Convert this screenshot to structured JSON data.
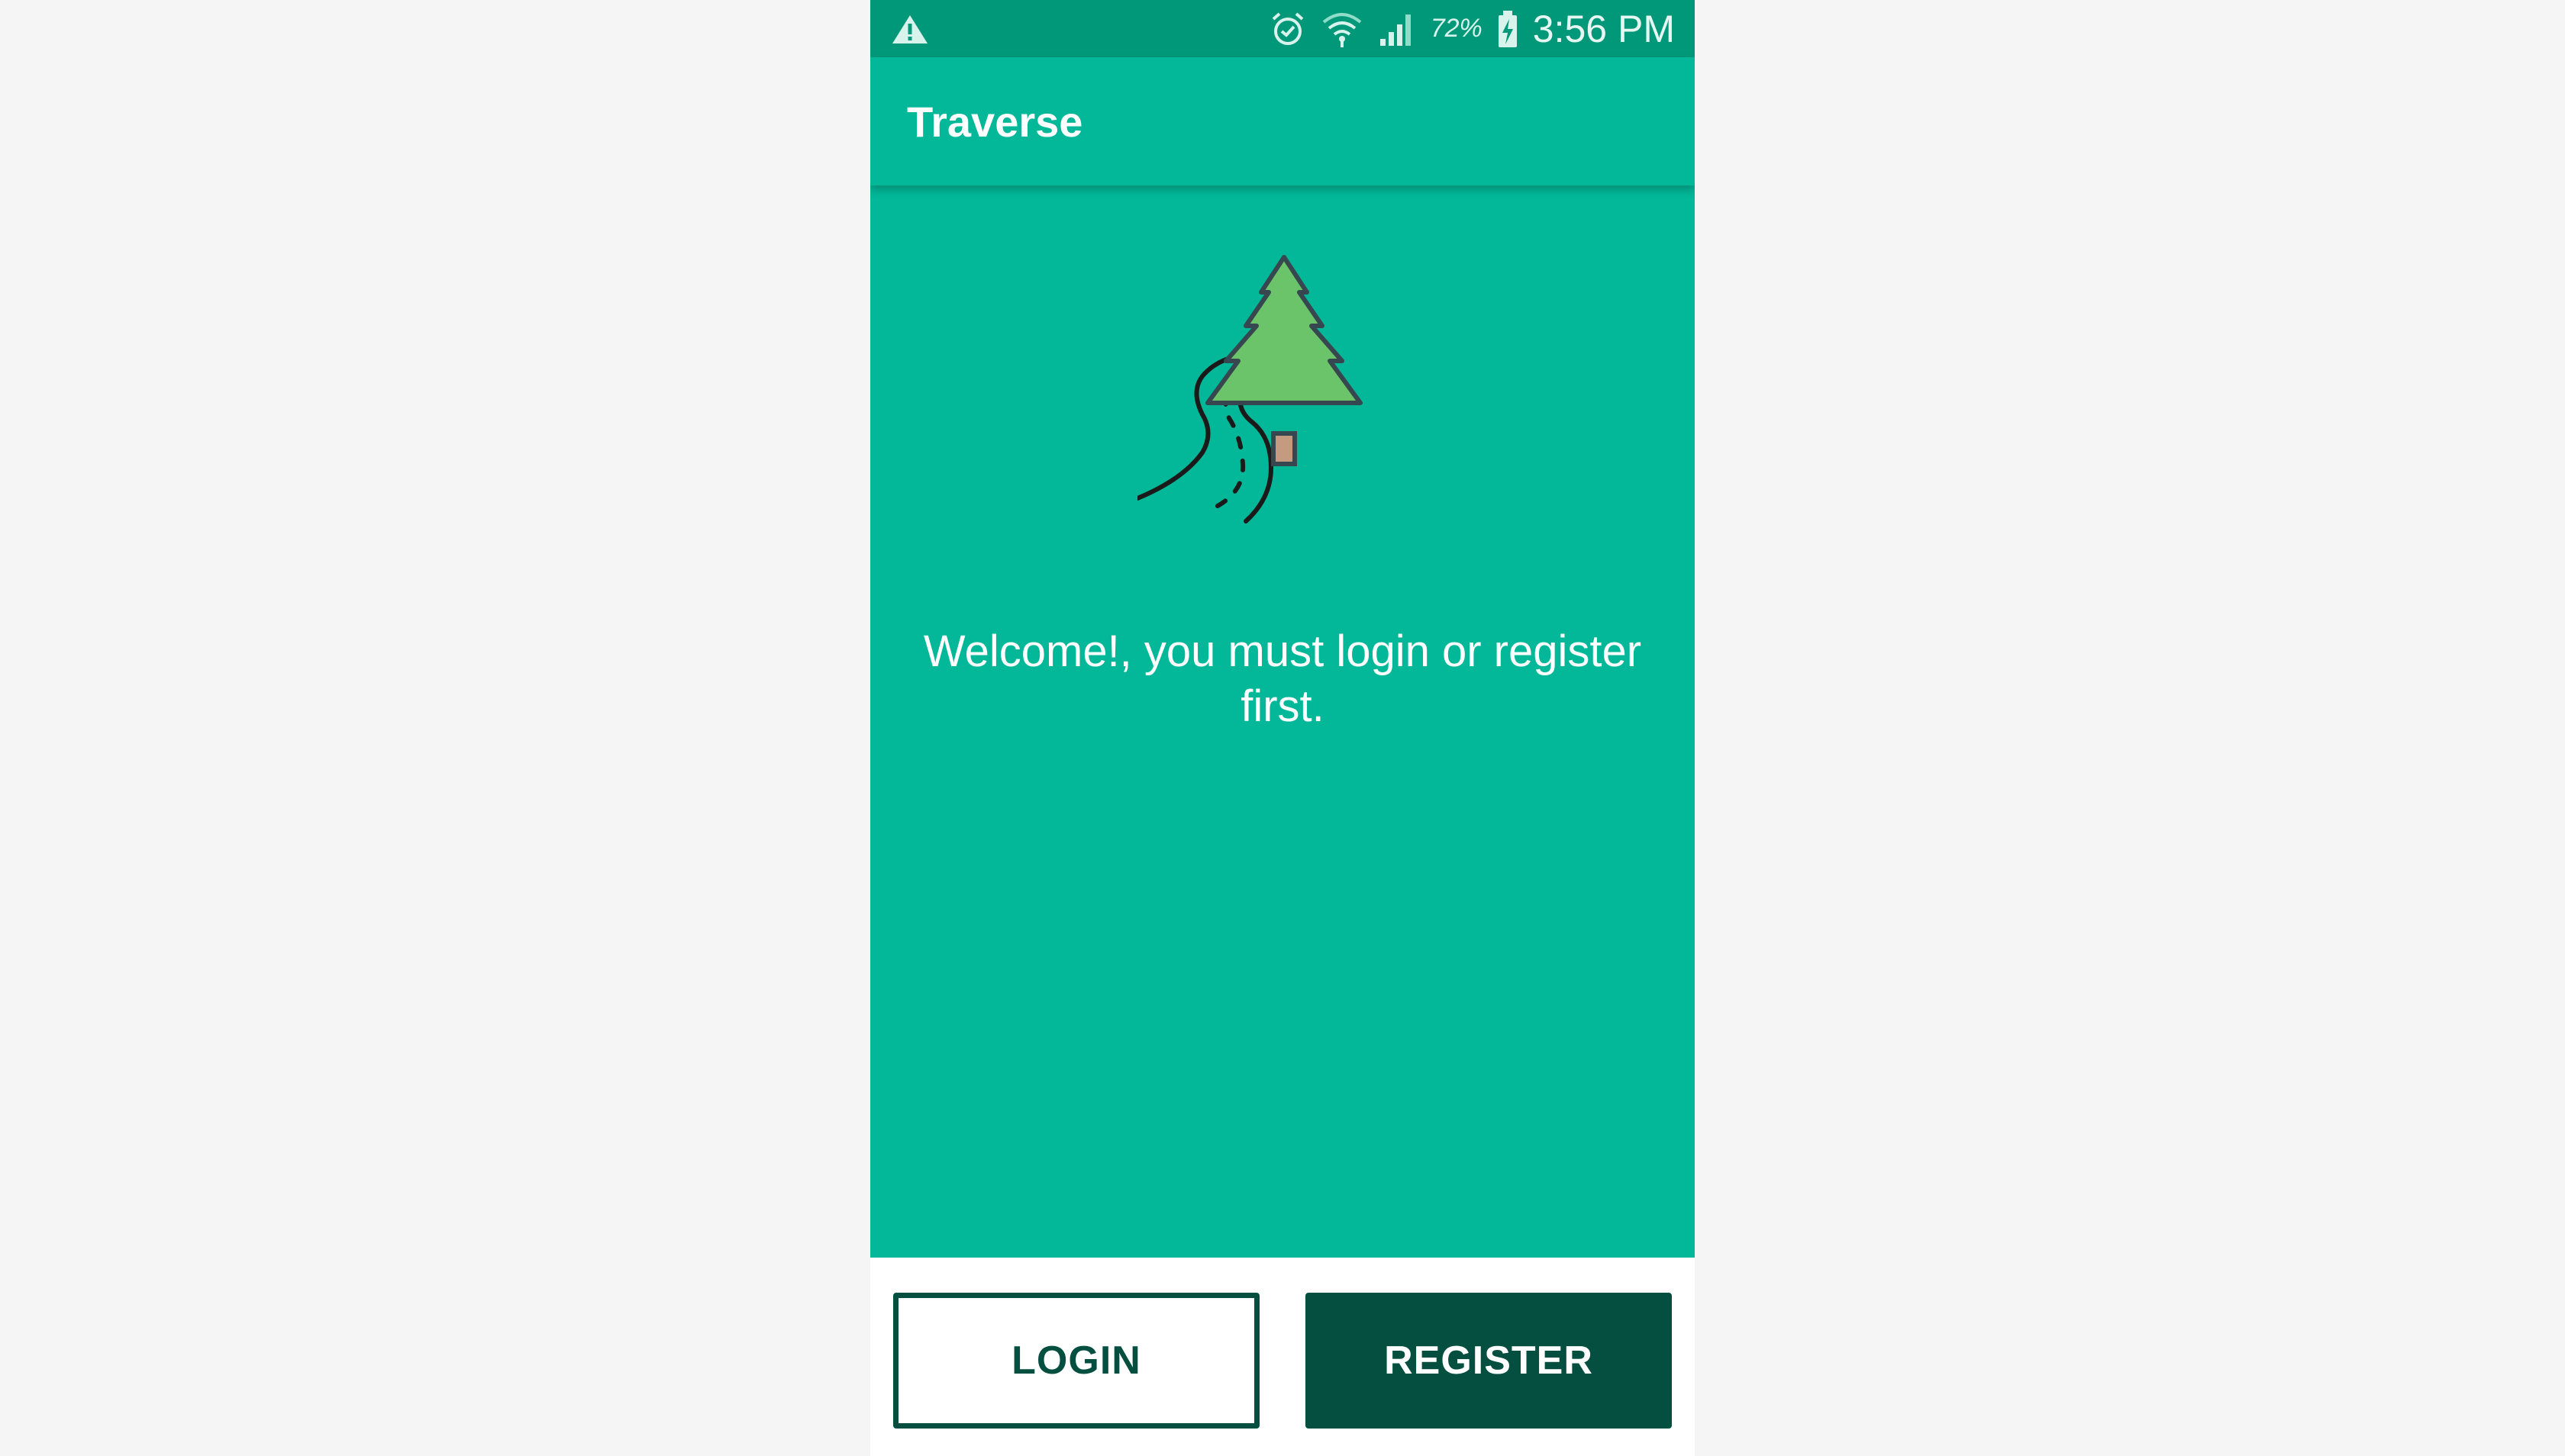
{
  "status_bar": {
    "battery_percent": "72%",
    "time": "3:56 PM",
    "icons": [
      "warning-icon",
      "alarm-icon",
      "wifi-icon",
      "signal-icon",
      "battery-charging-icon"
    ]
  },
  "app_bar": {
    "title": "Traverse"
  },
  "main": {
    "logo_icon": "road-and-tree-icon",
    "welcome_message": "Welcome!, you must login or register first."
  },
  "actions": {
    "login_label": "LOGIN",
    "register_label": "REGISTER"
  },
  "colors": {
    "status_bar": "#009879",
    "primary": "#02b898",
    "dark_accent": "#054f40",
    "tree_green": "#6cc46a",
    "outline": "#37474f"
  }
}
